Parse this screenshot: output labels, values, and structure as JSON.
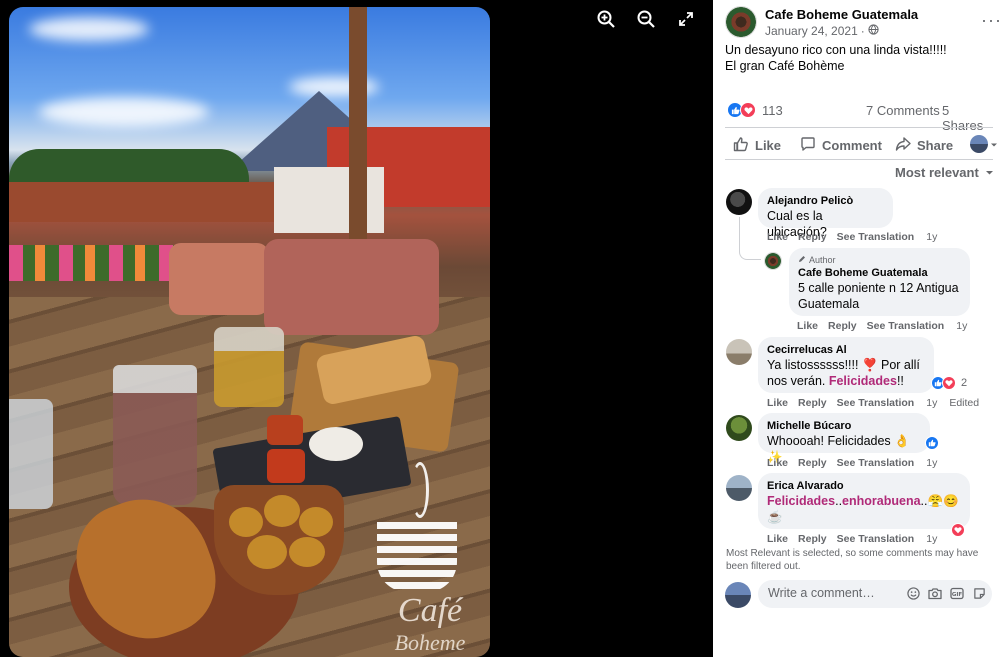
{
  "page": {
    "name": "Cafe Boheme Guatemala",
    "date": "January 24, 2021",
    "date_separator": "·",
    "privacy_icon": "globe-icon",
    "more_label": "···",
    "post_text_line1": "Un desayuno rico con una linda vista!!!!!",
    "post_text_line2": "El gran Café Bohème"
  },
  "photo": {
    "logo_line1": "Café",
    "logo_line2": "Boheme"
  },
  "viewer_tools": [
    {
      "name": "zoom-in-icon"
    },
    {
      "name": "zoom-out-icon"
    },
    {
      "name": "fullscreen-icon"
    }
  ],
  "stats": {
    "reactions_count": "113",
    "comments": "7 Comments",
    "shares": "5 Shares"
  },
  "actions": {
    "like": "Like",
    "comment": "Comment",
    "share": "Share"
  },
  "sort_label": "Most relevant",
  "comments": [
    {
      "author": "Alejandro Pelicò",
      "text": "Cual es la ubicación?",
      "like": "Like",
      "reply": "Reply",
      "translate": "See Translation",
      "time": "1y"
    },
    {
      "badge": "Author",
      "author": "Cafe Boheme Guatemala",
      "text": "5 calle poniente n 12 Antigua Guatemala",
      "like": "Like",
      "reply": "Reply",
      "translate": "See Translation",
      "time": "1y"
    },
    {
      "author": "Cecirrelucas Al",
      "text_a": "Ya listossssss!!!! ",
      "text_emoji": "❣️",
      "text_b": " Por allí nos verán. ",
      "text_hl": "Felicidades",
      "text_c": "!!",
      "reaction_count": "2",
      "like": "Like",
      "reply": "Reply",
      "translate": "See Translation",
      "time": "1y",
      "edited": "Edited"
    },
    {
      "author": "Michelle Búcaro",
      "text": "Whoooah! Felicidades ",
      "text_emoji": "👌✨",
      "like": "Like",
      "reply": "Reply",
      "translate": "See Translation",
      "time": "1y"
    },
    {
      "author": "Erica Alvarado",
      "text_hl1": "Felicidades",
      "text_mid": "..",
      "text_hl2": "enhorabuena",
      "text_end": "..😤😊",
      "text_line2": "☕",
      "like": "Like",
      "reply": "Reply",
      "translate": "See Translation",
      "time": "1y"
    }
  ],
  "filter_note": "Most Relevant is selected, so some comments may have been filtered out.",
  "composer": {
    "placeholder": "Write a comment…",
    "icons": [
      "emoji-icon",
      "camera-icon",
      "gif-icon",
      "sticker-icon"
    ]
  },
  "colors": {
    "like_blue": "#1877f2",
    "love_red": "#f33e58",
    "highlight": "#b02a78",
    "secondary_text": "#65676b",
    "bubble_bg": "#f0f2f5"
  }
}
